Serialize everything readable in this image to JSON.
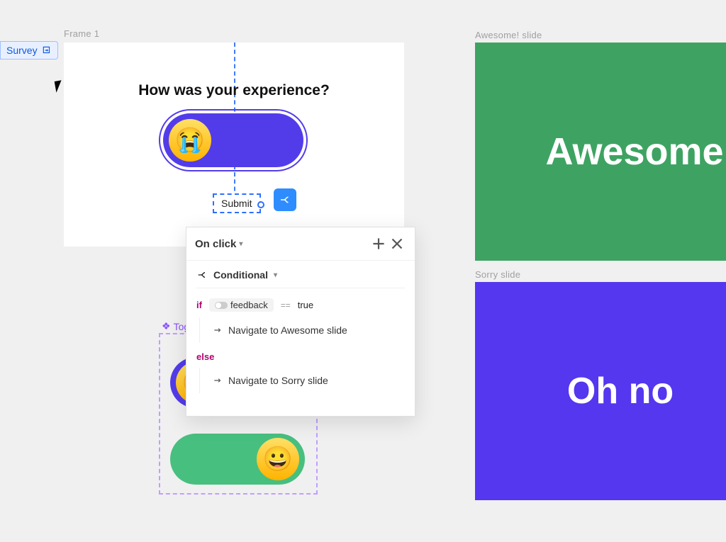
{
  "chip": {
    "label": "Survey"
  },
  "frame": {
    "main_label": "Frame 1",
    "heading": "How was your experience?",
    "submit_label": "Submit"
  },
  "component": {
    "label": "Toggle"
  },
  "panel": {
    "trigger": "On click",
    "section": "Conditional",
    "if_kw": "if",
    "else_kw": "else",
    "variable": "feedback",
    "operator": "==",
    "value": "true",
    "action_if": "Navigate to Awesome slide",
    "action_else": "Navigate to Sorry slide"
  },
  "slides": {
    "awesome_label": "Awesome! slide",
    "awesome_text": "Awesome",
    "sorry_label": "Sorry slide",
    "sorry_text": "Oh no"
  }
}
